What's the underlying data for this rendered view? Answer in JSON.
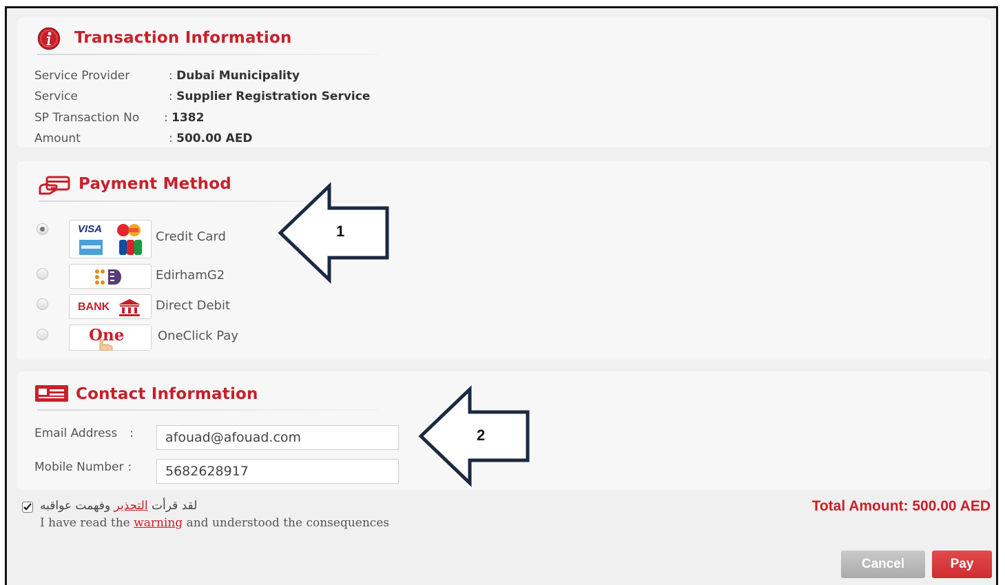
{
  "transaction": {
    "title": "Transaction Information",
    "rows": [
      {
        "label": "Service Provider",
        "value": "Dubai Municipality"
      },
      {
        "label": "Service",
        "value": "Supplier Registration Service"
      },
      {
        "label": "SP Transaction No",
        "value": "1382"
      },
      {
        "label": "Amount",
        "value": "500.00 AED"
      }
    ]
  },
  "payment": {
    "title": "Payment Method",
    "options": [
      {
        "label": "Credit Card",
        "selected": true,
        "logo": "visa-mastercard-amex-jcb-icon"
      },
      {
        "label": "EdirhamG2",
        "selected": false,
        "logo": "edirham-icon"
      },
      {
        "label": "Direct Debit",
        "selected": false,
        "logo": "bank-icon"
      },
      {
        "label": "OneClick Pay",
        "selected": false,
        "logo": "oneclick-icon"
      }
    ],
    "bank_logo_text": "BANK",
    "one_logo_text": "One",
    "visa_text": "VISA"
  },
  "contact": {
    "title": "Contact Information",
    "email_label": "Email Address",
    "email_value": "afouad@afouad.com",
    "mobile_label": "Mobile Number",
    "mobile_value": "5682628917"
  },
  "agreement": {
    "checked": true,
    "arabic_prefix": "لقد قرأت",
    "arabic_link": "التحذير",
    "arabic_suffix": "وفهمت عواقبه",
    "english_prefix": "I have read the",
    "english_link": "warning",
    "english_suffix": "and understood the consequences"
  },
  "total": {
    "label": "Total Amount:",
    "value": "500.00 AED"
  },
  "buttons": {
    "cancel": "Cancel",
    "pay": "Pay"
  },
  "annotations": {
    "arrow1": "1",
    "arrow2": "2"
  },
  "colors": {
    "accent": "#c8202a",
    "arrow": "#1b2a41",
    "pay": "#d9383b",
    "cancel": "#b9b9b9"
  }
}
